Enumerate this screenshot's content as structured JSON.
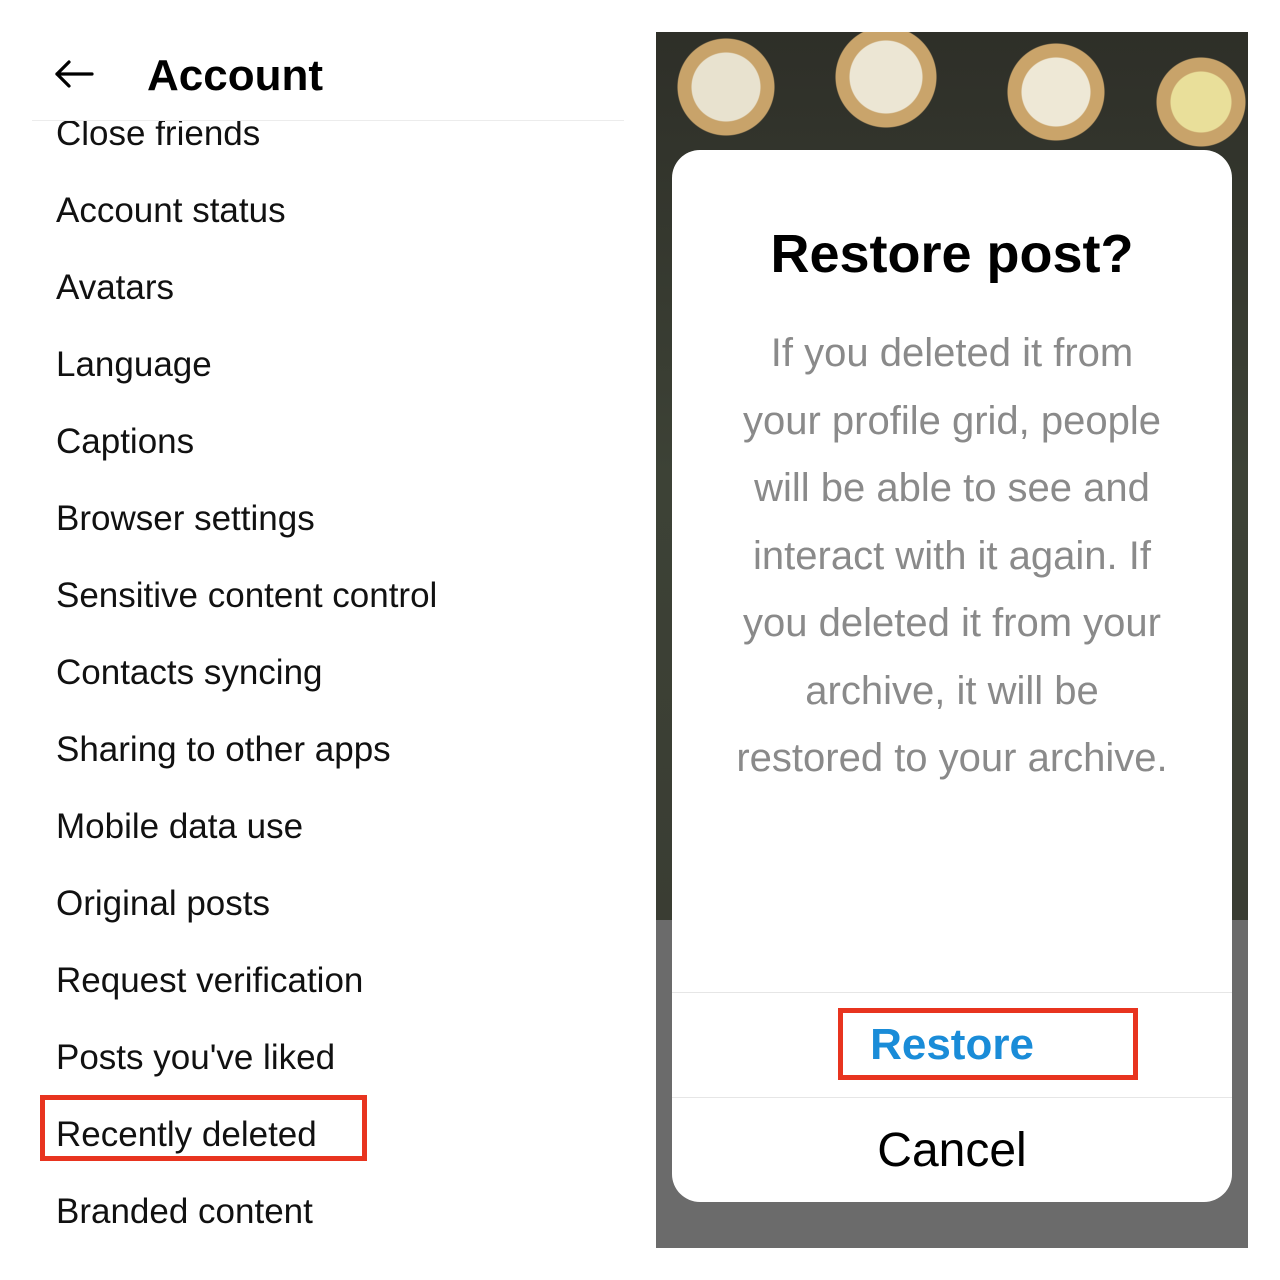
{
  "account_screen": {
    "title": "Account",
    "menu_items": [
      "Close friends",
      "Account status",
      "Avatars",
      "Language",
      "Captions",
      "Browser settings",
      "Sensitive content control",
      "Contacts syncing",
      "Sharing to other apps",
      "Mobile data use",
      "Original posts",
      "Request verification",
      "Posts you've liked",
      "Recently deleted",
      "Branded content"
    ],
    "highlighted_item": "Recently deleted"
  },
  "restore_dialog": {
    "title": "Restore post?",
    "body": "If you deleted it from your profile grid, people will be able to see and interact with it again. If you deleted it from your archive, it will be restored to your archive.",
    "restore_label": "Restore",
    "cancel_label": "Cancel"
  },
  "colors": {
    "highlight": "#e8341f",
    "restore_blue": "#1a8cd8"
  },
  "icons": {
    "back": "arrow-left-icon"
  }
}
